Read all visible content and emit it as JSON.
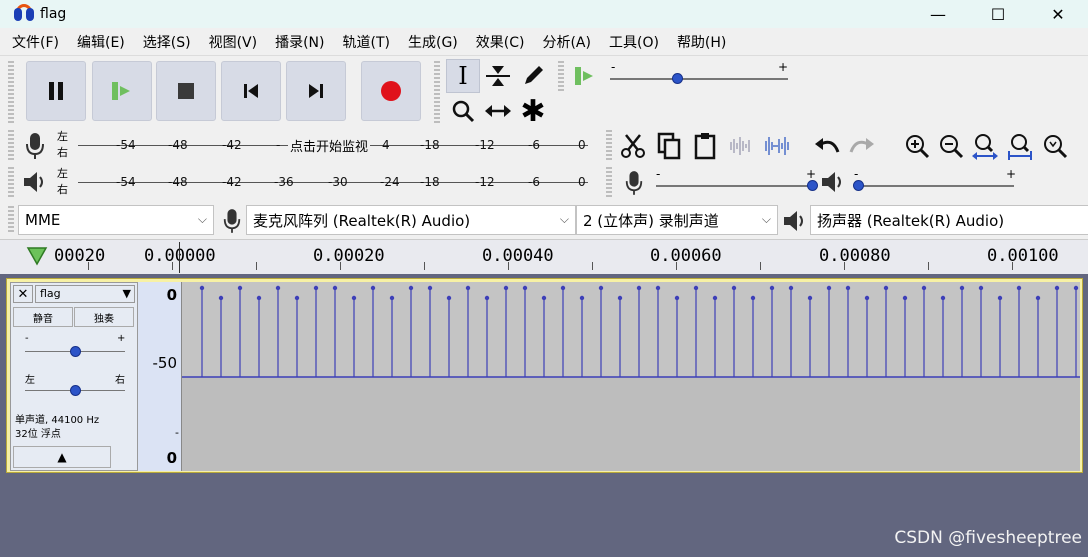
{
  "window": {
    "title": "flag",
    "minimize": "—",
    "maximize": "☐",
    "close": "✕"
  },
  "menu": [
    "文件(F)",
    "编辑(E)",
    "选择(S)",
    "视图(V)",
    "播录(N)",
    "轨道(T)",
    "生成(G)",
    "效果(C)",
    "分析(A)",
    "工具(O)",
    "帮助(H)"
  ],
  "playback_speed": {
    "min": "-",
    "max": "+",
    "level": 0.57
  },
  "record_meter": {
    "lr": [
      "左",
      "右"
    ],
    "ticks": [
      "-54",
      "-48",
      "-42",
      "-",
      "4",
      "-18",
      "-12",
      "-6",
      "0"
    ],
    "hint": "点击开始监视"
  },
  "play_meter": {
    "lr": [
      "左",
      "右"
    ],
    "ticks": [
      "-54",
      "-48",
      "-42",
      "-36",
      "-30",
      "-24",
      "-18",
      "-12",
      "-6",
      "0"
    ]
  },
  "mixer": {
    "record_volume": {
      "min": "-",
      "max": "+",
      "level": 1.0
    },
    "play_volume": {
      "min": "-",
      "max": "+",
      "level": 0.0
    }
  },
  "devices": {
    "host": "MME",
    "input": "麦克风阵列 (Realtek(R) Audio)",
    "channels": "2 (立体声) 录制声道",
    "output": "扬声器 (Realtek(R) Audio)"
  },
  "timeline": {
    "labels": [
      "00020",
      "0.00000",
      "0.00020",
      "0.00040",
      "0.00060",
      "0.00080",
      "0.00100"
    ]
  },
  "track": {
    "name": "flag",
    "mute": "静音",
    "solo": "独奏",
    "gain": {
      "min": "-",
      "max": "+",
      "level": 0.5
    },
    "pan": {
      "left": "左",
      "right": "右",
      "level": 0.5
    },
    "info_line1": "单声道, 44100 Hz",
    "info_line2": "32位 浮点",
    "ruler": [
      "0",
      "-50",
      "-",
      "0"
    ],
    "close": "✕",
    "menu_arrow": "▼",
    "collapse": "▲"
  },
  "watermark": "CSDN @fivesheeptree"
}
